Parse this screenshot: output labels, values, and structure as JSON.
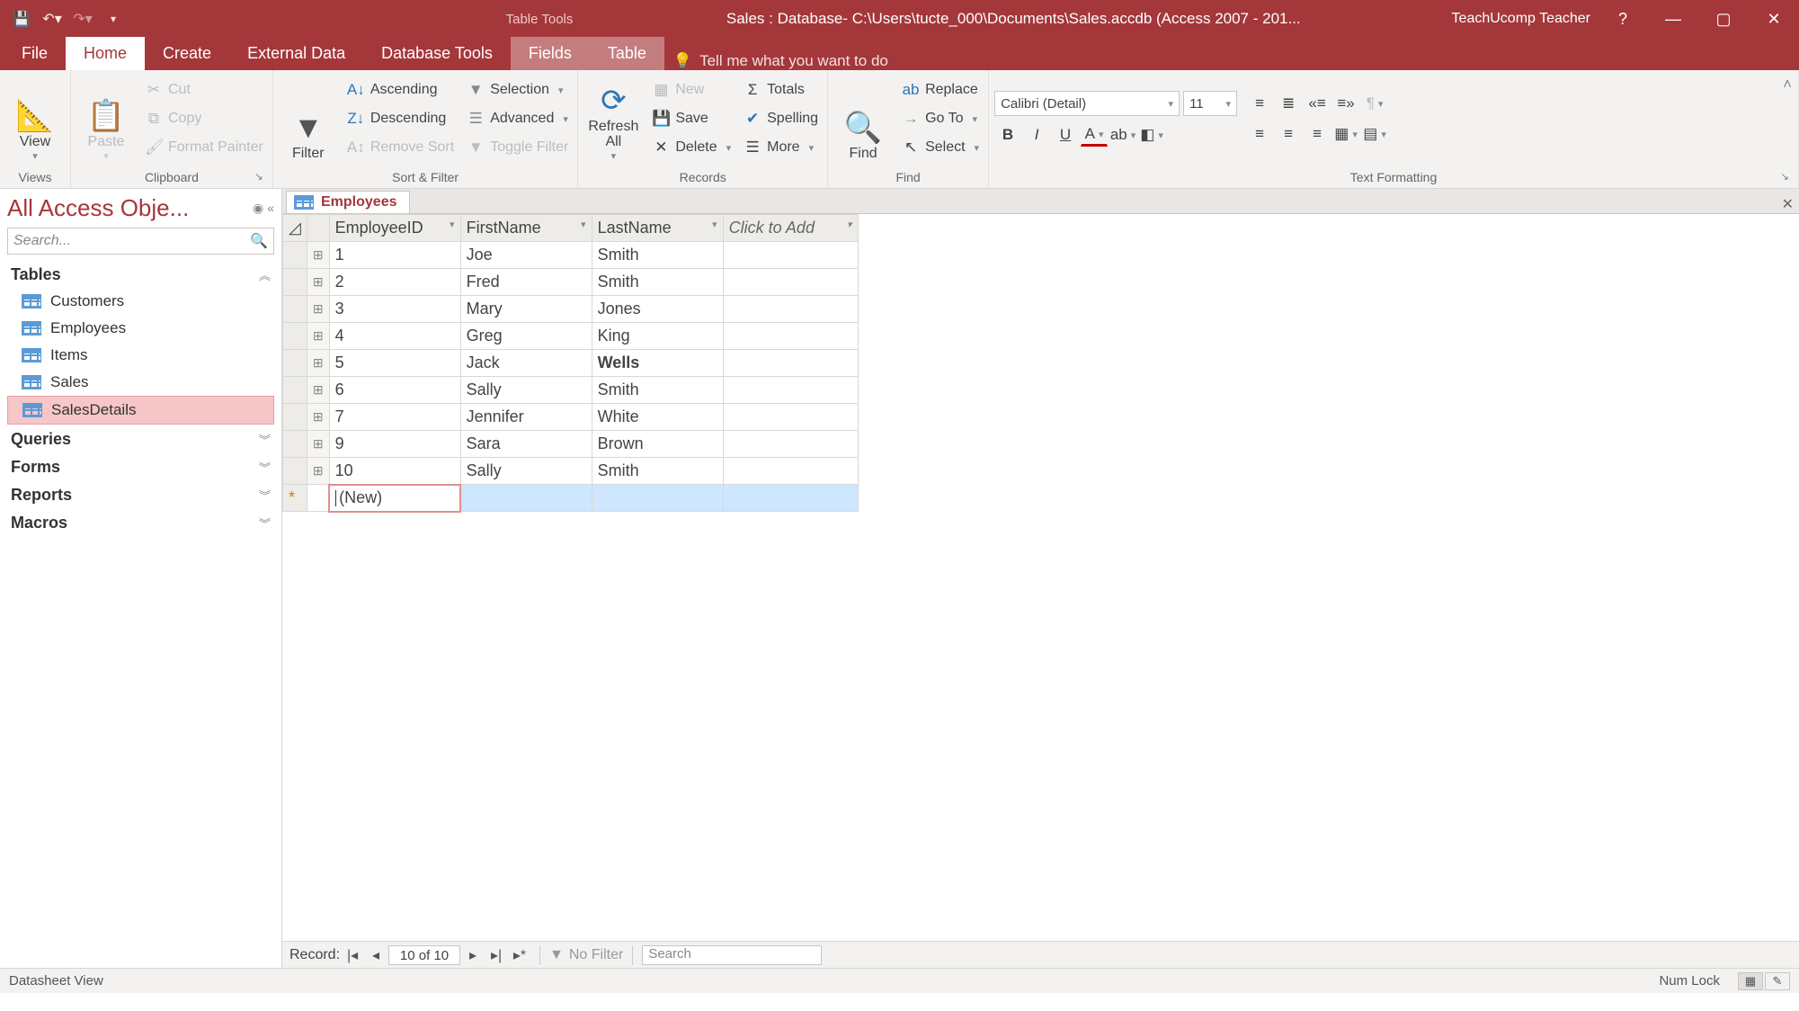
{
  "titlebar": {
    "tools_label": "Table Tools",
    "title": "Sales : Database- C:\\Users\\tucte_000\\Documents\\Sales.accdb (Access 2007 - 201...",
    "user": "TeachUcomp Teacher",
    "help": "?"
  },
  "tabs": {
    "file": "File",
    "home": "Home",
    "create": "Create",
    "external": "External Data",
    "dbtools": "Database Tools",
    "fields": "Fields",
    "table": "Table",
    "tell": "Tell me what you want to do"
  },
  "ribbon": {
    "views": {
      "label": "Views",
      "view": "View"
    },
    "clipboard": {
      "label": "Clipboard",
      "paste": "Paste",
      "cut": "Cut",
      "copy": "Copy",
      "fmt": "Format Painter"
    },
    "sort": {
      "label": "Sort & Filter",
      "filter": "Filter",
      "asc": "Ascending",
      "desc": "Descending",
      "rem": "Remove Sort",
      "sel": "Selection",
      "adv": "Advanced",
      "tog": "Toggle Filter"
    },
    "records": {
      "label": "Records",
      "refresh": "Refresh All",
      "new": "New",
      "save": "Save",
      "delete": "Delete",
      "totals": "Totals",
      "spell": "Spelling",
      "more": "More"
    },
    "find": {
      "label": "Find",
      "find": "Find",
      "replace": "Replace",
      "goto": "Go To",
      "select": "Select"
    },
    "text": {
      "label": "Text Formatting",
      "font": "Calibri (Detail)",
      "size": "11"
    }
  },
  "nav": {
    "title": "All Access Obje...",
    "search": "Search...",
    "cats": {
      "tables": "Tables",
      "queries": "Queries",
      "forms": "Forms",
      "reports": "Reports",
      "macros": "Macros"
    },
    "tables": [
      "Customers",
      "Employees",
      "Items",
      "Sales",
      "SalesDetails"
    ],
    "selected": "SalesDetails"
  },
  "doc": {
    "tab": "Employees",
    "columns": {
      "id": "EmployeeID",
      "first": "FirstName",
      "last": "LastName",
      "add": "Click to Add"
    },
    "rows": [
      {
        "id": "1",
        "first": "Joe",
        "last": "Smith"
      },
      {
        "id": "2",
        "first": "Fred",
        "last": "Smith"
      },
      {
        "id": "3",
        "first": "Mary",
        "last": "Jones"
      },
      {
        "id": "4",
        "first": "Greg",
        "last": "King"
      },
      {
        "id": "5",
        "first": "Jack",
        "last": "Wells",
        "bold_last": true
      },
      {
        "id": "6",
        "first": "Sally",
        "last": "Smith"
      },
      {
        "id": "7",
        "first": "Jennifer",
        "last": "White"
      },
      {
        "id": "9",
        "first": "Sara",
        "last": "Brown"
      },
      {
        "id": "10",
        "first": "Sally",
        "last": "Smith"
      }
    ],
    "new_label": "(New)"
  },
  "recnav": {
    "label": "Record:",
    "pos": "10 of 10",
    "nofilter": "No Filter",
    "search": "Search"
  },
  "status": {
    "view": "Datasheet View",
    "numlock": "Num Lock"
  }
}
